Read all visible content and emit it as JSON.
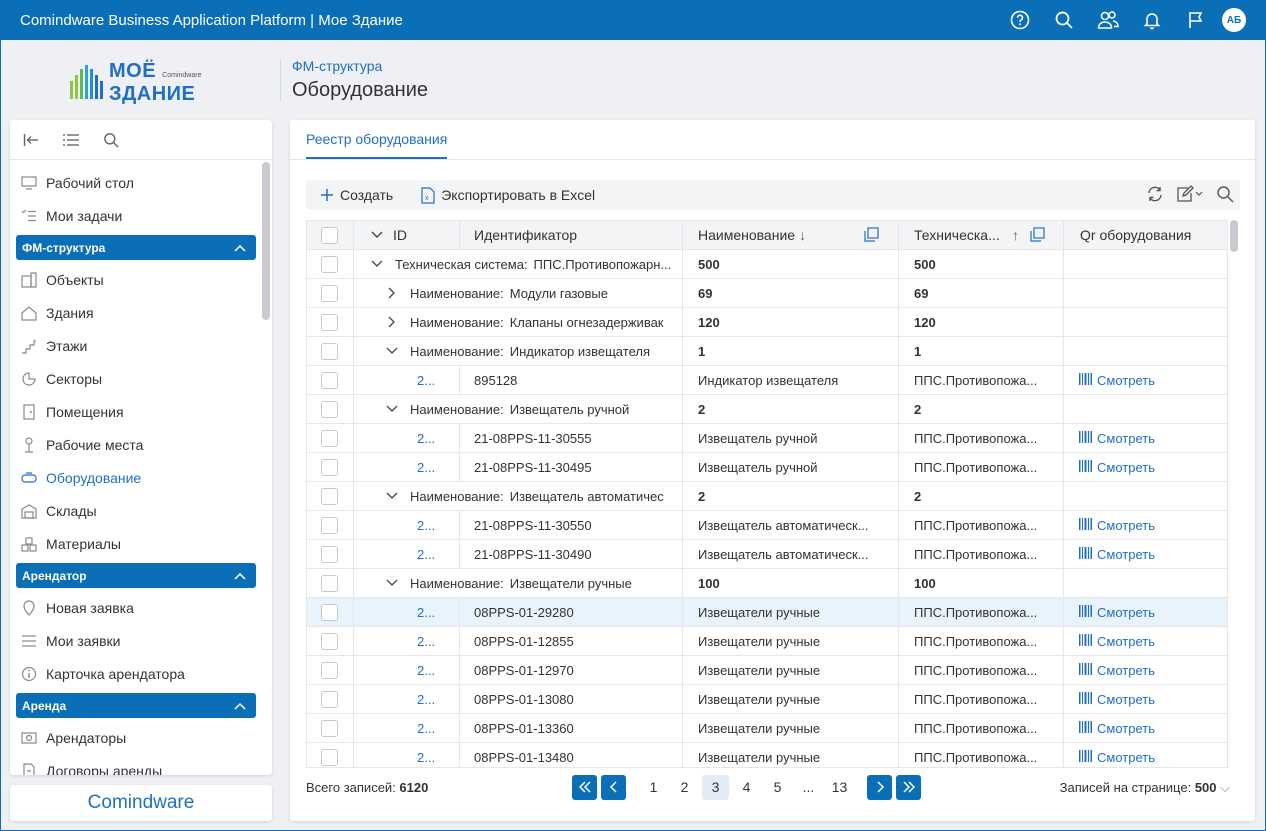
{
  "app": {
    "title": "Comindware Business Application Platform  |  Мое Здание",
    "avatar_initials": "АБ",
    "accent_color": "#0a6fb6"
  },
  "header": {
    "breadcrumb": "ФМ-структура",
    "page_title": "Оборудование",
    "logo_line1": "МОЁ",
    "logo_line2": "ЗДАНИЕ",
    "logo_small": "Comindware"
  },
  "sidebar": {
    "items_top": [
      {
        "label": "Рабочий стол",
        "icon": "desktop-icon"
      },
      {
        "label": "Мои задачи",
        "icon": "tasks-icon"
      }
    ],
    "sections": [
      {
        "title": "ФМ-структура",
        "items": [
          {
            "label": "Объекты",
            "icon": "objects-icon"
          },
          {
            "label": "Здания",
            "icon": "building-icon"
          },
          {
            "label": "Этажи",
            "icon": "stairs-icon"
          },
          {
            "label": "Секторы",
            "icon": "sector-icon"
          },
          {
            "label": "Помещения",
            "icon": "door-icon"
          },
          {
            "label": "Рабочие места",
            "icon": "workplace-icon"
          },
          {
            "label": "Оборудование",
            "icon": "equipment-icon",
            "active": true
          },
          {
            "label": "Склады",
            "icon": "warehouse-icon"
          },
          {
            "label": "Материалы",
            "icon": "materials-icon"
          }
        ]
      },
      {
        "title": "Арендатор",
        "items": [
          {
            "label": "Новая заявка",
            "icon": "pin-icon"
          },
          {
            "label": "Мои заявки",
            "icon": "list-icon"
          },
          {
            "label": "Карточка арендатора",
            "icon": "info-icon"
          }
        ]
      },
      {
        "title": "Аренда",
        "items": [
          {
            "label": "Арендаторы",
            "icon": "tenants-icon"
          },
          {
            "label": "Договоры аренды",
            "icon": "contract-icon"
          }
        ]
      }
    ],
    "brand": "Comindware"
  },
  "main": {
    "tab": "Реестр оборудования",
    "toolbar": {
      "create": "Создать",
      "export": "Экспортировать в Excel"
    },
    "columns": [
      "ID",
      "Идентификатор",
      "Наименование",
      "Техническа...",
      "Qr оборудования"
    ],
    "rows": [
      {
        "type": "group",
        "level": 0,
        "expanded": true,
        "label": "Техническая система:",
        "value": "ППС.Противопожарн...",
        "c1": "500",
        "c2": "500"
      },
      {
        "type": "group",
        "level": 1,
        "expanded": false,
        "label": "Наименование:",
        "value": "Модули газовые",
        "c1": "69",
        "c2": "69"
      },
      {
        "type": "group",
        "level": 1,
        "expanded": false,
        "label": "Наименование:",
        "value": "Клапаны огнезадерживак",
        "c1": "120",
        "c2": "120"
      },
      {
        "type": "group",
        "level": 1,
        "expanded": true,
        "label": "Наименование:",
        "value": "Индикатор извещателя",
        "c1": "1",
        "c2": "1"
      },
      {
        "type": "data",
        "id": "2...",
        "ident": "895128",
        "name": "Индикатор извещателя",
        "tech": "ППС.Противопожа...",
        "qr": "Смотреть"
      },
      {
        "type": "group",
        "level": 1,
        "expanded": true,
        "label": "Наименование:",
        "value": "Извещатель ручной",
        "c1": "2",
        "c2": "2"
      },
      {
        "type": "data",
        "id": "2...",
        "ident": "21-08PPS-11-30555",
        "name": "Извещатель ручной",
        "tech": "ППС.Противопожа...",
        "qr": "Смотреть"
      },
      {
        "type": "data",
        "id": "2...",
        "ident": "21-08PPS-11-30495",
        "name": "Извещатель ручной",
        "tech": "ППС.Противопожа...",
        "qr": "Смотреть"
      },
      {
        "type": "group",
        "level": 1,
        "expanded": true,
        "label": "Наименование:",
        "value": "Извещатель автоматичес",
        "c1": "2",
        "c2": "2"
      },
      {
        "type": "data",
        "id": "2...",
        "ident": "21-08PPS-11-30550",
        "name": "Извещатель автоматическ...",
        "tech": "ППС.Противопожа...",
        "qr": "Смотреть"
      },
      {
        "type": "data",
        "id": "2...",
        "ident": "21-08PPS-11-30490",
        "name": "Извещатель автоматическ...",
        "tech": "ППС.Противопожа...",
        "qr": "Смотреть"
      },
      {
        "type": "group",
        "level": 1,
        "expanded": true,
        "label": "Наименование:",
        "value": "Извещатели ручные",
        "c1": "100",
        "c2": "100"
      },
      {
        "type": "data",
        "id": "2...",
        "ident": "08PPS-01-29280",
        "name": "Извещатели ручные",
        "tech": "ППС.Противопожа...",
        "qr": "Смотреть",
        "selected": true
      },
      {
        "type": "data",
        "id": "2...",
        "ident": "08PPS-01-12855",
        "name": "Извещатели ручные",
        "tech": "ППС.Противопожа...",
        "qr": "Смотреть"
      },
      {
        "type": "data",
        "id": "2...",
        "ident": "08PPS-01-12970",
        "name": "Извещатели ручные",
        "tech": "ППС.Противопожа...",
        "qr": "Смотреть"
      },
      {
        "type": "data",
        "id": "2...",
        "ident": "08PPS-01-13080",
        "name": "Извещатели ручные",
        "tech": "ППС.Противопожа...",
        "qr": "Смотреть"
      },
      {
        "type": "data",
        "id": "2...",
        "ident": "08PPS-01-13360",
        "name": "Извещатели ручные",
        "tech": "ППС.Противопожа...",
        "qr": "Смотреть"
      },
      {
        "type": "data",
        "id": "2...",
        "ident": "08PPS-01-13480",
        "name": "Извещатели ручные",
        "tech": "ППС.Противопожа...",
        "qr": "Смотреть"
      }
    ],
    "footer": {
      "total_label": "Всего записей:",
      "total_value": "6120",
      "pages": [
        "1",
        "2",
        "3",
        "4",
        "5",
        "...",
        "13"
      ],
      "current_page": "3",
      "per_page_label": "Записей на странице:",
      "per_page_value": "500"
    }
  }
}
